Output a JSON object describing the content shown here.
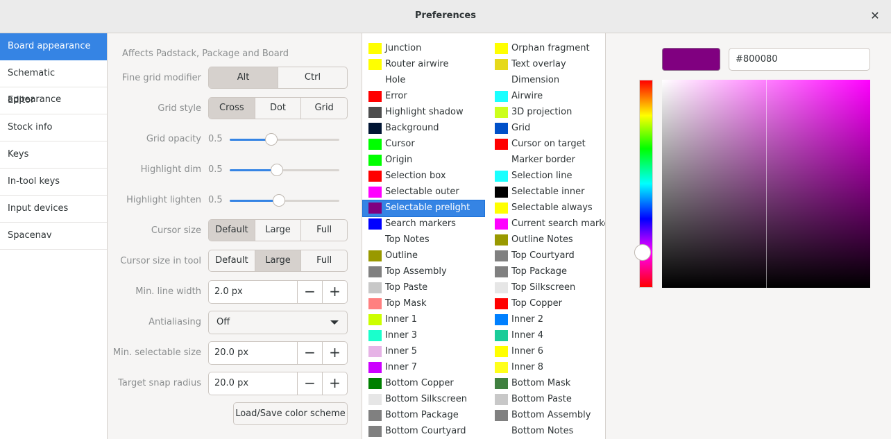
{
  "window": {
    "title": "Preferences"
  },
  "sidebar": {
    "items": [
      {
        "label": "Board appearance",
        "active": true
      },
      {
        "label": "Schematic appearance"
      },
      {
        "label": "Editor"
      },
      {
        "label": "Stock info"
      },
      {
        "label": "Keys"
      },
      {
        "label": "In-tool keys"
      },
      {
        "label": "Input devices"
      },
      {
        "label": "Spacenav"
      }
    ]
  },
  "settings": {
    "hint": "Affects Padstack, Package and Board",
    "fine_grid_modifier": {
      "label": "Fine grid modifier",
      "options": [
        "Alt",
        "Ctrl"
      ],
      "selected": "Alt"
    },
    "grid_style": {
      "label": "Grid style",
      "options": [
        "Cross",
        "Dot",
        "Grid"
      ],
      "selected": "Cross"
    },
    "grid_opacity": {
      "label": "Grid opacity",
      "value": "0.5",
      "fraction": 0.38
    },
    "highlight_dim": {
      "label": "Highlight dim",
      "value": "0.5",
      "fraction": 0.43
    },
    "highlight_lighten": {
      "label": "Highlight lighten",
      "value": "0.5",
      "fraction": 0.45
    },
    "cursor_size": {
      "label": "Cursor size",
      "options": [
        "Default",
        "Large",
        "Full"
      ],
      "selected": "Default"
    },
    "cursor_size_in_tool": {
      "label": "Cursor size in tool",
      "options": [
        "Default",
        "Large",
        "Full"
      ],
      "selected": "Large"
    },
    "min_line_width": {
      "label": "Min. line width",
      "value": "2.0 px"
    },
    "antialiasing": {
      "label": "Antialiasing",
      "value": "Off"
    },
    "min_selectable_size": {
      "label": "Min. selectable size",
      "value": "20.0 px"
    },
    "target_snap_radius": {
      "label": "Target snap radius",
      "value": "20.0 px"
    },
    "load_save": "Load/Save color scheme",
    "minus": "−",
    "plus": "+"
  },
  "colors_left": [
    {
      "label": "Junction",
      "color": "#ffff00"
    },
    {
      "label": "Router airwire",
      "color": "#ffff00"
    },
    {
      "label": "Hole",
      "color": "#ffffff"
    },
    {
      "label": "Error",
      "color": "#ff0000"
    },
    {
      "label": "Highlight shadow",
      "color": "#4d4d4d"
    },
    {
      "label": "Background",
      "color": "#001433"
    },
    {
      "label": "Cursor",
      "color": "#00ff00"
    },
    {
      "label": "Origin",
      "color": "#00ff00"
    },
    {
      "label": "Selection box",
      "color": "#ff0000"
    },
    {
      "label": "Selectable outer",
      "color": "#ff00ff"
    },
    {
      "label": "Selectable prelight",
      "color": "#800080",
      "selected": true
    },
    {
      "label": "Search markers",
      "color": "#0000ff"
    },
    {
      "label": "Top Notes",
      "color": "#ffffff"
    },
    {
      "label": "Outline",
      "color": "#999900"
    },
    {
      "label": "Top Assembly",
      "color": "#808080"
    },
    {
      "label": "Top Paste",
      "color": "#c8c8c8"
    },
    {
      "label": "Top Mask",
      "color": "#ff8080"
    },
    {
      "label": "Inner 1",
      "color": "#ccff00"
    },
    {
      "label": "Inner 3",
      "color": "#1affcc"
    },
    {
      "label": "Inner 5",
      "color": "#e6b3e6"
    },
    {
      "label": "Inner 7",
      "color": "#cc00ff"
    },
    {
      "label": "Bottom Copper",
      "color": "#008000"
    },
    {
      "label": "Bottom Silkscreen",
      "color": "#e6e6e6"
    },
    {
      "label": "Bottom Package",
      "color": "#808080"
    },
    {
      "label": "Bottom Courtyard",
      "color": "#808080"
    }
  ],
  "colors_right": [
    {
      "label": "Orphan fragment",
      "color": "#ffff00"
    },
    {
      "label": "Text overlay",
      "color": "#e6d91a"
    },
    {
      "label": "Dimension",
      "color": "#ffffff"
    },
    {
      "label": "Airwire",
      "color": "#1affff"
    },
    {
      "label": "3D projection",
      "color": "#ccff1a"
    },
    {
      "label": "Grid",
      "color": "#0050c8"
    },
    {
      "label": "Cursor on target",
      "color": "#ff0000"
    },
    {
      "label": "Marker border",
      "color": "#ffffff"
    },
    {
      "label": "Selection line",
      "color": "#1affff"
    },
    {
      "label": "Selectable inner",
      "color": "#000000"
    },
    {
      "label": "Selectable always",
      "color": "#ffff00"
    },
    {
      "label": "Current search marker",
      "color": "#ff00ff"
    },
    {
      "label": "Outline Notes",
      "color": "#999900"
    },
    {
      "label": "Top Courtyard",
      "color": "#808080"
    },
    {
      "label": "Top Package",
      "color": "#808080"
    },
    {
      "label": "Top Silkscreen",
      "color": "#e6e6e6"
    },
    {
      "label": "Top Copper",
      "color": "#ff0000"
    },
    {
      "label": "Inner 2",
      "color": "#0080ff"
    },
    {
      "label": "Inner 4",
      "color": "#1acc99"
    },
    {
      "label": "Inner 6",
      "color": "#ffff00"
    },
    {
      "label": "Inner 8",
      "color": "#ffff1a"
    },
    {
      "label": "Bottom Mask",
      "color": "#408040"
    },
    {
      "label": "Bottom Paste",
      "color": "#c8c8c8"
    },
    {
      "label": "Bottom Assembly",
      "color": "#808080"
    },
    {
      "label": "Bottom Notes",
      "color": "#ffffff"
    }
  ],
  "picker": {
    "hex": "#800080",
    "color": "#800080"
  },
  "accent": "#3584e4"
}
